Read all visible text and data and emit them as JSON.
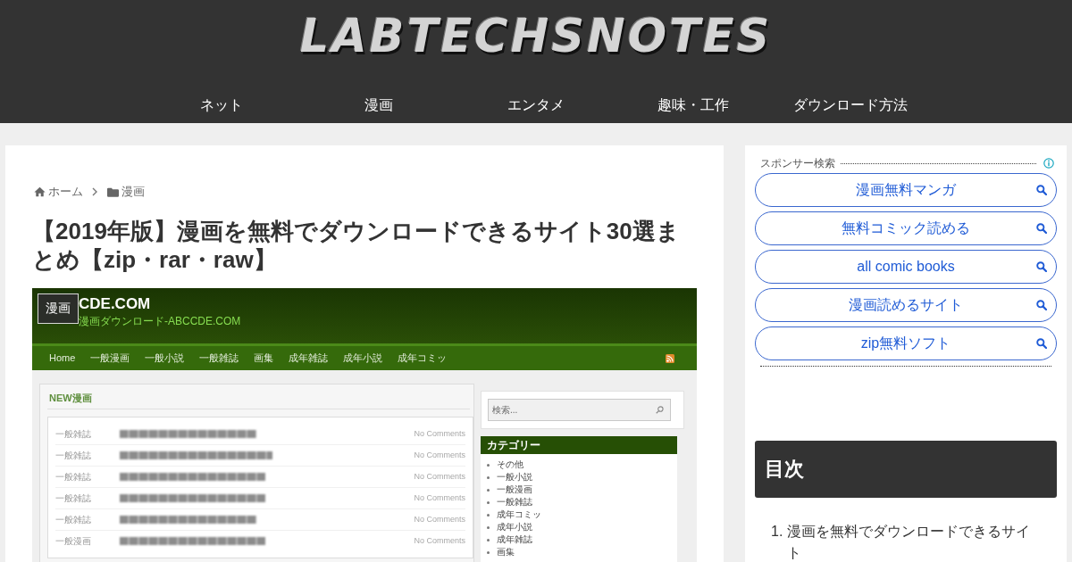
{
  "header": {
    "logo": "LABTECHSNOTES",
    "nav": [
      {
        "label": "ネット"
      },
      {
        "label": "漫画"
      },
      {
        "label": "エンタメ"
      },
      {
        "label": "趣味・工作"
      },
      {
        "label": "ダウンロード方法"
      }
    ]
  },
  "breadcrumb": [
    {
      "kind": "home",
      "label": "ホーム"
    },
    {
      "kind": "category",
      "label": "漫画"
    }
  ],
  "article": {
    "title": "【2019年版】漫画を無料でダウンロードできるサイト30選まとめ【zip・rar・raw】",
    "eyecatch": {
      "category_label": "漫画",
      "screenshot": {
        "site_title": "CDE.COM",
        "site_subtitle": "漫画ダウンロード-ABCCDE.COM",
        "nav": [
          "Home",
          "一般漫画",
          "一般小説",
          "一般雑誌",
          "画集",
          "成年雑誌",
          "成年小説",
          "成年コミッ"
        ],
        "section_title": "NEW漫画",
        "posts": [
          {
            "category": "一般雑誌",
            "comments": "No Comments"
          },
          {
            "category": "一般雑誌",
            "comments": "No Comments"
          },
          {
            "category": "一般雑誌",
            "comments": "No Comments"
          },
          {
            "category": "一般雑誌",
            "comments": "No Comments"
          },
          {
            "category": "一般雑誌",
            "comments": "No Comments"
          },
          {
            "category": "一般漫画",
            "comments": "No Comments"
          }
        ],
        "search": {
          "placeholder": "検索..."
        },
        "categories_title": "カテゴリー",
        "categories": [
          "その他",
          "一般小説",
          "一般漫画",
          "一般雑誌",
          "成年コミッ",
          "成年小説",
          "成年雑誌",
          "画集"
        ]
      }
    }
  },
  "sidebar": {
    "sponsor_search": {
      "label": "スポンサー検索",
      "links": [
        {
          "label": "漫画無料マンガ"
        },
        {
          "label": "無料コミック読める"
        },
        {
          "label": "all comic books"
        },
        {
          "label": "漫画読めるサイト"
        },
        {
          "label": "zip無料ソフト"
        }
      ]
    },
    "toc": {
      "title": "目次",
      "items": [
        {
          "number": "1.",
          "label": "漫画を無料でダウンロードできるサイト"
        }
      ]
    }
  }
}
